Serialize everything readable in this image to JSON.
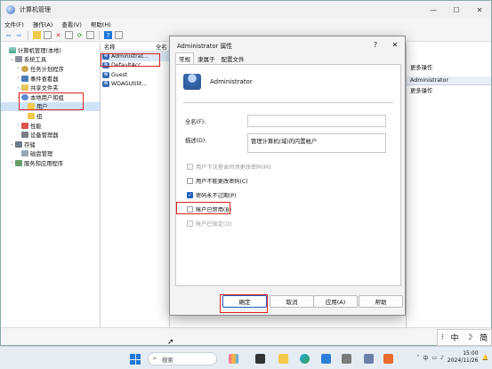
{
  "window": {
    "title": "计算机管理",
    "menus": [
      "文件(F)",
      "操作(A)",
      "查看(V)",
      "帮助(H)"
    ]
  },
  "tree": [
    {
      "label": "计算机管理(本地)",
      "level": 0,
      "arrow": "",
      "icon": "computer-icon"
    },
    {
      "label": "系统工具",
      "level": 1,
      "arrow": "⌄",
      "icon": "tools-icon"
    },
    {
      "label": "任务计划程序",
      "level": 2,
      "arrow": "›",
      "icon": "task-scheduler-icon"
    },
    {
      "label": "事件查看器",
      "level": 2,
      "arrow": "›",
      "icon": "event-viewer-icon"
    },
    {
      "label": "共享文件夹",
      "level": 2,
      "arrow": "›",
      "icon": "shared-folder-icon"
    },
    {
      "label": "本地用户和组",
      "level": 2,
      "arrow": "⌄",
      "icon": "users-icon"
    },
    {
      "label": "用户",
      "level": 3,
      "arrow": "",
      "icon": "folder-icon",
      "selected": true
    },
    {
      "label": "组",
      "level": 3,
      "arrow": "",
      "icon": "folder-icon"
    },
    {
      "label": "性能",
      "level": 2,
      "arrow": "›",
      "icon": "performance-icon"
    },
    {
      "label": "设备管理器",
      "level": 2,
      "arrow": "",
      "icon": "device-manager-icon"
    },
    {
      "label": "存储",
      "level": 1,
      "arrow": "⌄",
      "icon": "storage-icon"
    },
    {
      "label": "磁盘管理",
      "level": 2,
      "arrow": "",
      "icon": "disk-icon"
    },
    {
      "label": "服务和应用程序",
      "level": 1,
      "arrow": "›",
      "icon": "services-icon"
    }
  ],
  "list": {
    "headers": [
      "名称",
      "全名"
    ],
    "rows": [
      "Administrat...",
      "DefaultAcc...",
      "Guest",
      "WDAGUtilit..."
    ]
  },
  "actions": {
    "items": [
      "更多操作",
      "Administrator",
      "更多操作"
    ]
  },
  "dialog": {
    "title": "Administrator 属性",
    "help": "?",
    "close": "✕",
    "tabs": [
      "常规",
      "隶属于",
      "配置文件"
    ],
    "username": "Administrator",
    "fullname_label": "全名(F):",
    "fullname_value": "",
    "desc_label": "描述(D):",
    "desc_value": "管理计算机(域)的内置帐户",
    "checks": [
      {
        "label": "用户下次登录时须更改密码(M)",
        "checked": false,
        "disabled": true
      },
      {
        "label": "用户不能更改密码(C)",
        "checked": false,
        "disabled": false
      },
      {
        "label": "密码永不过期(P)",
        "checked": true,
        "disabled": false
      },
      {
        "label": "帐户已禁用(B)",
        "checked": false,
        "disabled": false
      },
      {
        "label": "帐户已锁定(O)",
        "checked": false,
        "disabled": true
      }
    ],
    "buttons": {
      "ok": "确定",
      "cancel": "取消",
      "apply": "应用(A)",
      "help": "帮助"
    }
  },
  "ime": [
    "中",
    "简"
  ],
  "taskbar": {
    "search_placeholder": "搜索",
    "time": "15:00",
    "date": "2024/11/26"
  },
  "colors": {
    "highlight_box": "#e02020",
    "accent": "#1f5fbf"
  }
}
